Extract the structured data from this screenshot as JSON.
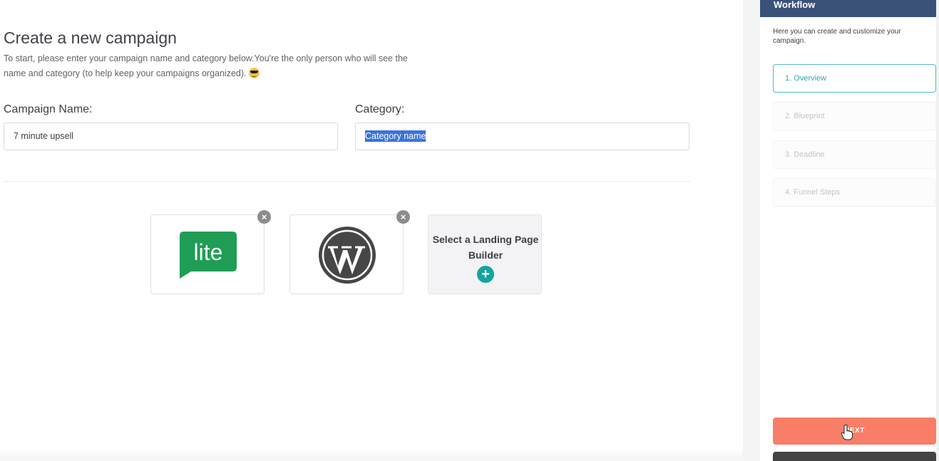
{
  "main": {
    "title": "Create a new campaign",
    "description": "To start, please enter your campaign name and category below.You're the only person who will see the name and category (to help keep your campaigns organized).",
    "emoji_icon": "sunglasses-emoji-icon",
    "campaign_name_label": "Campaign Name:",
    "campaign_name_value": "7 minute upsell",
    "category_label": "Category:",
    "category_value": "Category name",
    "builders": [
      {
        "name": "lite",
        "icon": "lite-logo-icon",
        "remove_label": "×"
      },
      {
        "name": "WordPress",
        "icon": "wordpress-logo-icon",
        "remove_label": "×"
      }
    ],
    "add_builder_label": "Select a Landing Page Builder",
    "add_builder_plus": "+"
  },
  "sidebar": {
    "header": "Workflow",
    "description": "Here you can create and customize your campaign.",
    "steps": [
      {
        "label": "1. Overview",
        "active": true
      },
      {
        "label": "2. Blueprint",
        "active": false
      },
      {
        "label": "3. Deadline",
        "active": false
      },
      {
        "label": "4. Funnel Steps",
        "active": false
      }
    ],
    "next_label": "NEXT"
  },
  "colors": {
    "header": "#3a5279",
    "accent_teal": "#12a5a0",
    "active_step": "#4fb8c5",
    "next_button": "#f87e67",
    "lite_green": "#1f9d55",
    "wordpress_gray": "#464646",
    "selection": "#3b73d9"
  }
}
